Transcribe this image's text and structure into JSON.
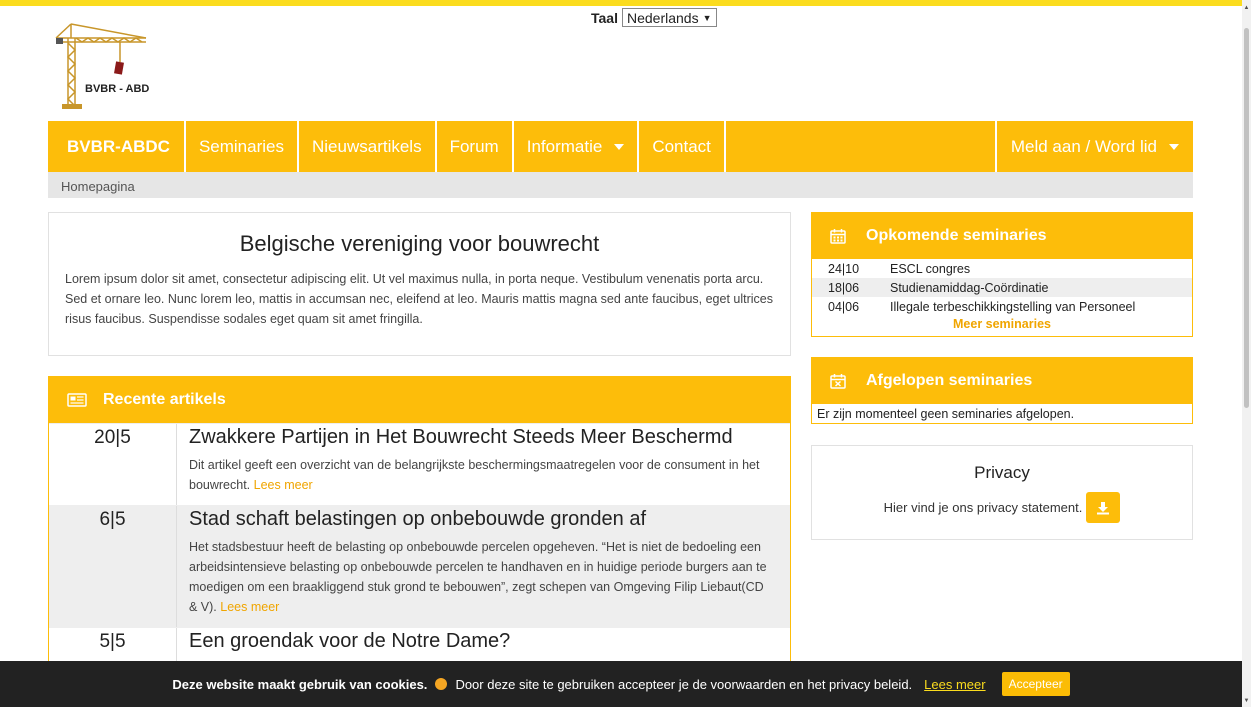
{
  "language": {
    "label": "Taal",
    "selected": "Nederlands"
  },
  "logo": {
    "text": "BVBR - ABDC"
  },
  "nav": {
    "brand": "BVBR-ABDC",
    "items": [
      "Seminaries",
      "Nieuwsartikels",
      "Forum",
      "Informatie",
      "Contact"
    ],
    "right": "Meld aan / Word lid"
  },
  "breadcrumb": "Homepagina",
  "intro": {
    "title": "Belgische vereniging voor bouwrecht",
    "text": "Lorem ipsum dolor sit amet, consectetur adipiscing elit. Ut vel maximus nulla, in porta neque. Vestibulum venenatis porta arcu. Sed et ornare leo. Nunc lorem leo, mattis in accumsan nec, eleifend at leo. Mauris mattis magna sed ante faucibus, eget ultrices risus faucibus. Suspendisse sodales eget quam sit amet fringilla."
  },
  "articles": {
    "heading": "Recente artikels",
    "more_label": "Lees meer",
    "items": [
      {
        "date": "20|5",
        "title": "Zwakkere Partijen in Het Bouwrecht Steeds Meer Beschermd",
        "text": "Dit artikel geeft een overzicht van de belangrijkste beschermingsmaatregelen voor de consument in het bouwrecht."
      },
      {
        "date": "6|5",
        "title": "Stad schaft belastingen op onbebouwde gronden af",
        "text": "Het stadsbestuur heeft de belasting op onbebouwde percelen opgeheven. “Het is niet de bedoeling een arbeidsintensieve belasting op onbebouwde percelen te handhaven en in huidige periode burgers aan te moedigen om een braakliggend stuk grond te bebouwen”, zegt schepen van Omgeving Filip Liebaut(CD & V)."
      },
      {
        "date": "5|5",
        "title": "Een groendak voor de Notre Dame?",
        "text": ""
      }
    ]
  },
  "upcoming": {
    "heading": "Opkomende seminaries",
    "items": [
      {
        "date": "24|10",
        "title": "ESCL congres"
      },
      {
        "date": "18|06",
        "title": "Studienamiddag-Coördinatie"
      },
      {
        "date": "04|06",
        "title": "Illegale terbeschikkingstelling van Personeel"
      }
    ],
    "more": "Meer seminaries"
  },
  "past": {
    "heading": "Afgelopen seminaries",
    "message": "Er zijn momenteel geen seminaries afgelopen."
  },
  "privacy": {
    "title": "Privacy",
    "text": "Hier vind je ons privacy statement."
  },
  "cookie": {
    "bold": "Deze website maakt gebruik van cookies.",
    "text": "Door deze site te gebruiken accepteer je de voorwaarden en het privacy beleid.",
    "link": "Lees meer",
    "accept": "Accepteer"
  },
  "colors": {
    "accent": "#fdbd0a",
    "topbar": "#fbdc1e",
    "cookie_bg": "#222222"
  }
}
